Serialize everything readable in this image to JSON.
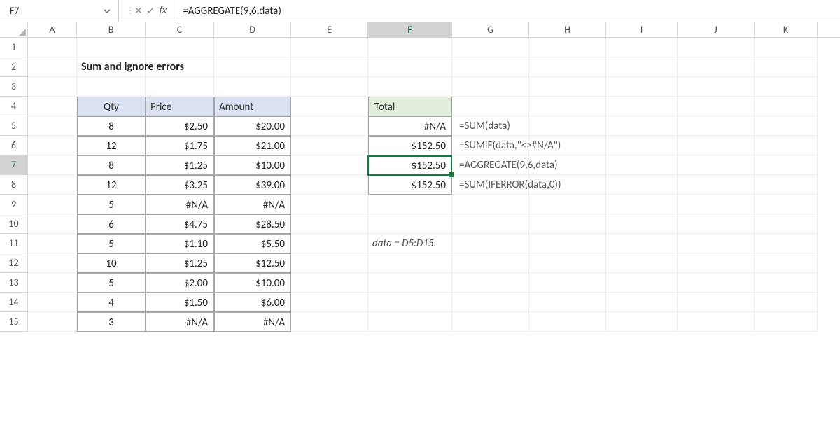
{
  "namebox": "F7",
  "formula": "=AGGREGATE(9,6,data)",
  "columns": [
    "A",
    "B",
    "C",
    "D",
    "E",
    "F",
    "G",
    "H",
    "I",
    "J",
    "K"
  ],
  "active_col": "F",
  "active_row": 7,
  "row_count": 15,
  "title": "Sum and ignore errors",
  "headers": {
    "qty": "Qty",
    "price": "Price",
    "amount": "Amount"
  },
  "rows": [
    {
      "qty": "8",
      "price": "$2.50",
      "amount": "$20.00"
    },
    {
      "qty": "12",
      "price": "$1.75",
      "amount": "$21.00"
    },
    {
      "qty": "8",
      "price": "$1.25",
      "amount": "$10.00"
    },
    {
      "qty": "12",
      "price": "$3.25",
      "amount": "$39.00"
    },
    {
      "qty": "5",
      "price": "#N/A",
      "amount": "#N/A"
    },
    {
      "qty": "6",
      "price": "$4.75",
      "amount": "$28.50"
    },
    {
      "qty": "5",
      "price": "$1.10",
      "amount": "$5.50"
    },
    {
      "qty": "10",
      "price": "$1.25",
      "amount": "$12.50"
    },
    {
      "qty": "5",
      "price": "$2.00",
      "amount": "$10.00"
    },
    {
      "qty": "4",
      "price": "$1.50",
      "amount": "$6.00"
    },
    {
      "qty": "3",
      "price": "#N/A",
      "amount": "#N/A"
    }
  ],
  "total_header": "Total",
  "totals": [
    "#N/A",
    "$152.50",
    "$152.50",
    "$152.50"
  ],
  "formulas": [
    "=SUM(data)",
    "=SUMIF(data,\"<>#N/A\")",
    "=AGGREGATE(9,6,data)",
    "=SUM(IFERROR(data,0))"
  ],
  "data_note": "data = D5:D15",
  "chart_data": {
    "type": "table",
    "title": "Sum and ignore errors",
    "columns": [
      "Qty",
      "Price",
      "Amount"
    ],
    "rows": [
      [
        8,
        2.5,
        20.0
      ],
      [
        12,
        1.75,
        21.0
      ],
      [
        8,
        1.25,
        10.0
      ],
      [
        12,
        3.25,
        39.0
      ],
      [
        5,
        null,
        null
      ],
      [
        6,
        4.75,
        28.5
      ],
      [
        5,
        1.1,
        5.5
      ],
      [
        10,
        1.25,
        12.5
      ],
      [
        5,
        2.0,
        10.0
      ],
      [
        4,
        1.5,
        6.0
      ],
      [
        3,
        null,
        null
      ]
    ],
    "summary": {
      "label": "Total",
      "SUM(data)": null,
      "SUMIF(data,\"<>#N/A\")": 152.5,
      "AGGREGATE(9,6,data)": 152.5,
      "SUM(IFERROR(data,0))": 152.5
    },
    "named_range": "data = D5:D15"
  }
}
